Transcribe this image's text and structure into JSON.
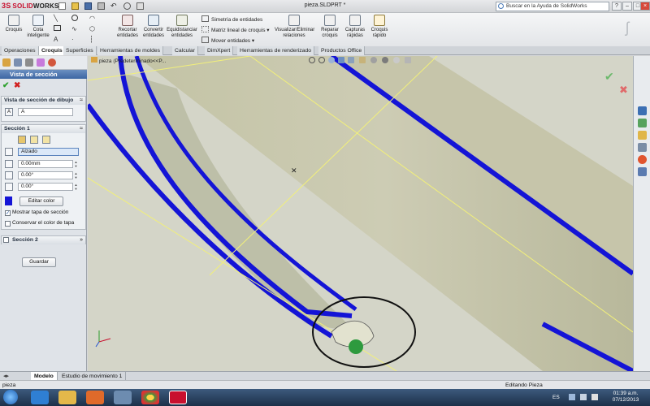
{
  "titlebar": {
    "logo_ds": "3S",
    "logo_solid": "SOLID",
    "logo_works": "WORKS",
    "document": "pieza.SLDPRT *",
    "help_placeholder": "Buscar en la Ayuda de SolidWorks"
  },
  "ribbon": {
    "croquis": "Croquis",
    "cota": [
      "Cota",
      "inteligente"
    ],
    "recortar": [
      "Recortar",
      "entidades"
    ],
    "convertir": [
      "Convertir",
      "entidades"
    ],
    "equidistanciar": [
      "Equidistanciar",
      "entidades"
    ],
    "simetria": "Simetría de entidades",
    "matriz": "Matriz lineal de croquis",
    "mover": "Mover entidades",
    "relaciones": [
      "Visualizar/Eliminar",
      "relaciones"
    ],
    "reparar": [
      "Reparar",
      "croquis"
    ],
    "capturas": [
      "Capturas",
      "rápidas"
    ],
    "croquis_rapido": [
      "Croquis",
      "rápido"
    ]
  },
  "tabs": [
    "Operaciones",
    "Croquis",
    "Superficies",
    "Herramientas de moldes",
    "Calcular",
    "DimXpert",
    "Herramientas de renderizado",
    "Productos Office"
  ],
  "active_tab": "Croquis",
  "tree": {
    "label": "pieza  (Predeterminado<<P..."
  },
  "property_manager": {
    "title": "Vista de sección",
    "group_drawing": {
      "title": "Vista de sección de dibujo",
      "name_value": "A"
    },
    "group_section1": {
      "title": "Sección 1",
      "plane_value": "Alzado",
      "offset_value": "0.00mm",
      "angle1_value": "0.00°",
      "angle2_value": "0.00°",
      "edit_color": "Editar color",
      "show_cap": "Mostrar tapa de sección",
      "keep_color": "Conservar el color de tapa",
      "cap_color": "#1414d6"
    },
    "group_section2": {
      "title": "Sección 2"
    },
    "save": "Guardar"
  },
  "bottom_tabs": [
    "Modelo",
    "Estudio de movimiento 1"
  ],
  "status": {
    "left": "pieza",
    "right": "Editando Pieza"
  },
  "taskbar": {
    "lang": "ES",
    "time": "01:39 a.m.",
    "date": "07/12/2013"
  },
  "colors": {
    "accent": "#3d66a3",
    "cut_edge": "#1414d6",
    "body": "#c9c8ae"
  }
}
